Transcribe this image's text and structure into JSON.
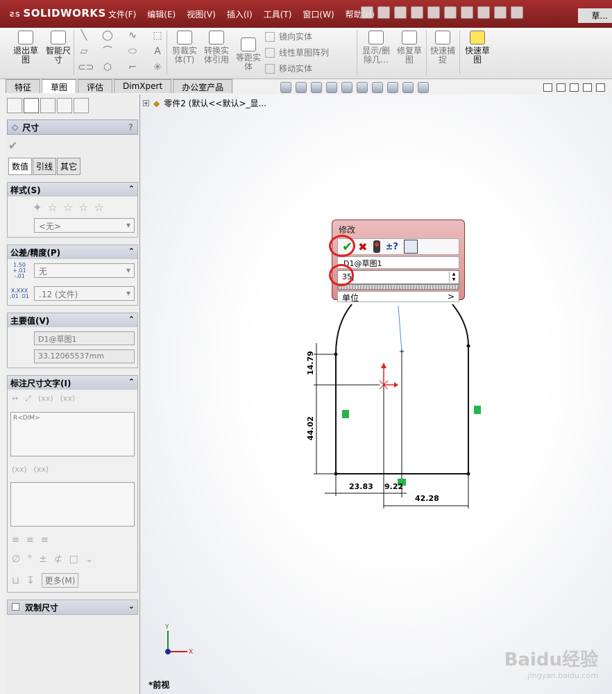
{
  "app": {
    "logo": "SOLIDWORKS",
    "window_title": "草..."
  },
  "menu": [
    "文件(F)",
    "编辑(E)",
    "视图(V)",
    "插入(I)",
    "工具(T)",
    "窗口(W)",
    "帮助(H)"
  ],
  "commands": {
    "exit_sketch": "退出草图",
    "smart_dim": "智能尺寸",
    "trim": "剪裁实体(T)",
    "convert": "转换实体引用",
    "offset": "等距实体",
    "mirror": "镜向实体",
    "linear_pattern": "线性草图阵列",
    "move": "移动实体",
    "show_delete": "显示/删除几...",
    "repair": "修复草图",
    "quick_snap": "快速捕捉",
    "rapid_sketch": "快速草图"
  },
  "tabs": [
    "特征",
    "草图",
    "评估",
    "DimXpert",
    "办公室产品"
  ],
  "active_tab": "草图",
  "property_manager": {
    "title": "尺寸",
    "help": "?",
    "subtabs": [
      "数值",
      "引线",
      "其它"
    ],
    "style_group": {
      "title": "样式(S)",
      "value": "<无>"
    },
    "tolerance_group": {
      "title": "公差/精度(P)",
      "tolerance": "无",
      "precision": ".12 (文件)",
      "tag1": "1.50 +.01 -.01",
      "tag2": "X.XXX .01 .01"
    },
    "primary_value": {
      "title": "主要值(V)",
      "name": "D1@草图1",
      "value": "33.12065537mm"
    },
    "dim_text": {
      "title": "标注尺寸文字(I)",
      "text": "R<DIM>",
      "xx1": "(xx)",
      "xx2": "(xx)",
      "xx3": "(xx)",
      "xx4": "(xx)",
      "more": "更多(M)"
    },
    "dual_dim": {
      "title": "双制尺寸"
    }
  },
  "tree": {
    "item": "零件2 (默认<<默认>_显..."
  },
  "modify_dialog": {
    "title": "修改",
    "dim_name": "D1@草图1",
    "value": "35",
    "unit_label": "单位",
    "unit_arrow": ">"
  },
  "sketch": {
    "dims": [
      "14.79",
      "44.02",
      "23.83",
      "9.22",
      "42.28"
    ]
  },
  "view_name": "*前视",
  "axes": {
    "x": "X",
    "y": "Y"
  },
  "watermark": {
    "main": "Baidu经验",
    "sub": "jingyan.baidu.com"
  },
  "colors": {
    "title_red": "#a72e2e",
    "accept_green": "#1b9c1b",
    "cancel_red": "#c01010",
    "highlight_circle": "#e02020"
  }
}
